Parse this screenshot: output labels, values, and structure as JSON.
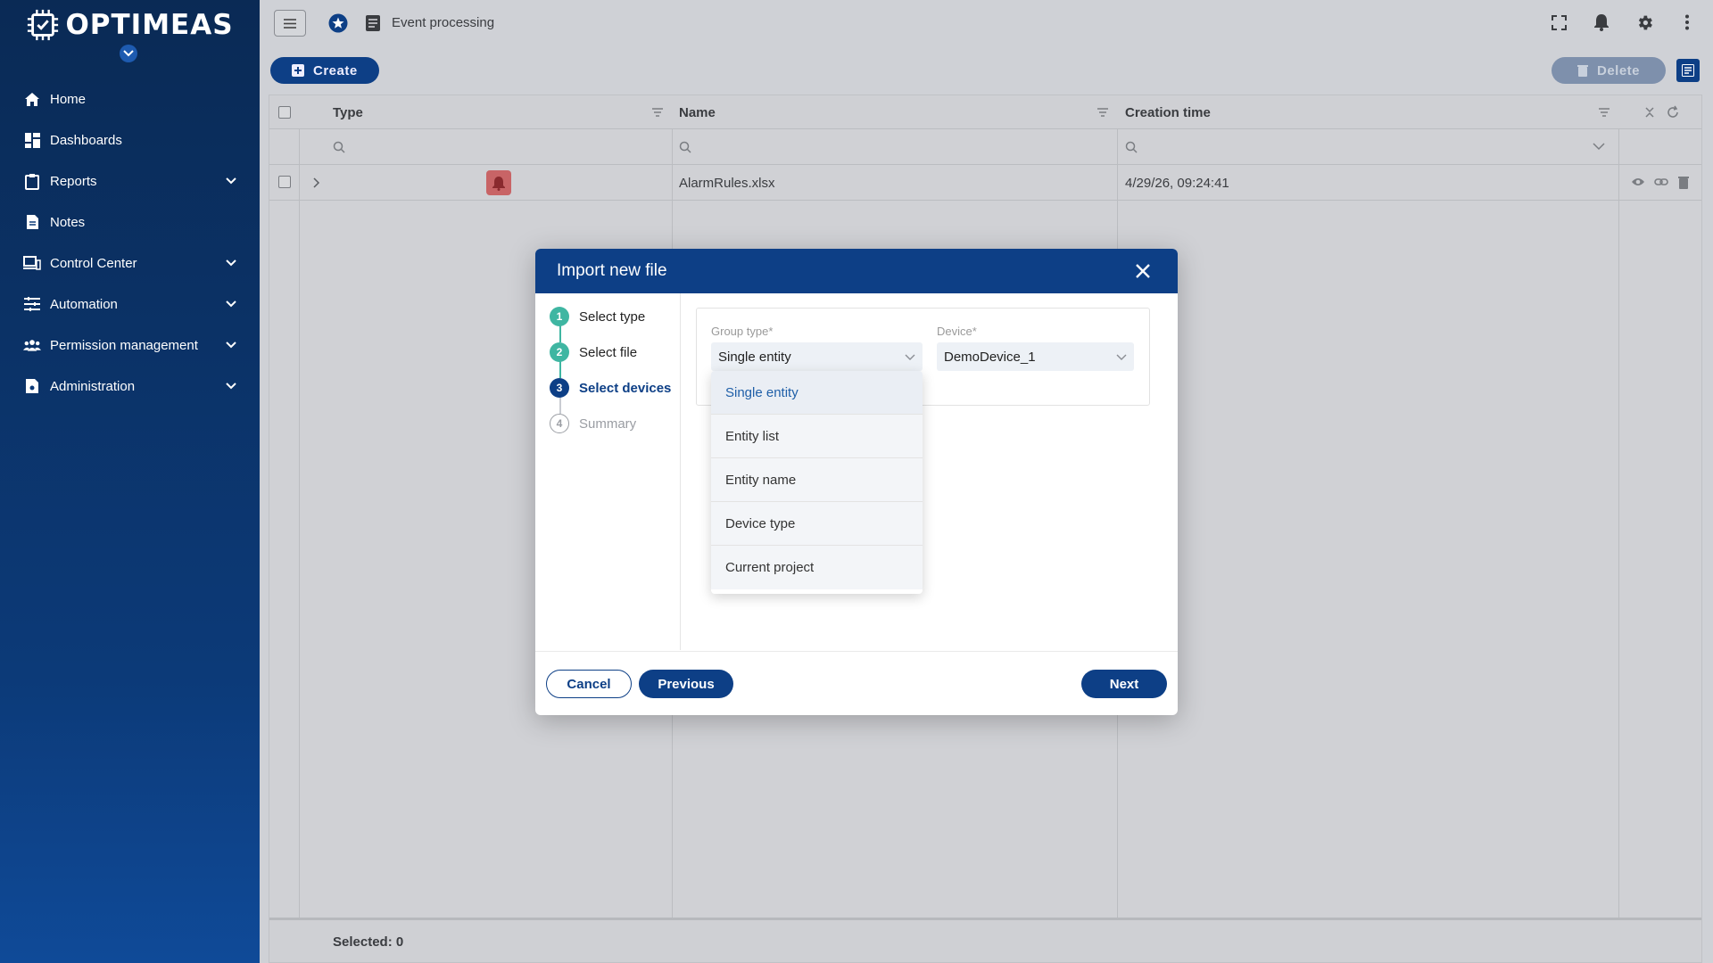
{
  "brand": {
    "name": "OPTIMEAS"
  },
  "sidebar": {
    "items": [
      {
        "label": "Home",
        "icon": "home-icon",
        "expandable": false
      },
      {
        "label": "Dashboards",
        "icon": "dashboard-icon",
        "expandable": false
      },
      {
        "label": "Reports",
        "icon": "clipboard-icon",
        "expandable": true
      },
      {
        "label": "Notes",
        "icon": "note-icon",
        "expandable": false
      },
      {
        "label": "Control Center",
        "icon": "devices-icon",
        "expandable": true
      },
      {
        "label": "Automation",
        "icon": "sliders-icon",
        "expandable": true
      },
      {
        "label": "Permission management",
        "icon": "users-icon",
        "expandable": true
      },
      {
        "label": "Administration",
        "icon": "admin-doc-icon",
        "expandable": true
      }
    ]
  },
  "topbar": {
    "breadcrumb": "Event processing"
  },
  "toolbar": {
    "create_label": "Create",
    "delete_label": "Delete"
  },
  "table": {
    "columns": [
      "Type",
      "Name",
      "Creation time"
    ],
    "rows": [
      {
        "type_icon": "alarm-bell-icon",
        "name": "AlarmRules.xlsx",
        "created": "4/29/26, 09:24:41"
      }
    ],
    "footer": "Selected: 0"
  },
  "modal": {
    "title": "Import new file",
    "steps": [
      {
        "num": "1",
        "label": "Select type",
        "state": "done"
      },
      {
        "num": "2",
        "label": "Select file",
        "state": "done"
      },
      {
        "num": "3",
        "label": "Select devices",
        "state": "active"
      },
      {
        "num": "4",
        "label": "Summary",
        "state": "pending"
      }
    ],
    "group_type": {
      "label": "Group type*",
      "value": "Single entity"
    },
    "device": {
      "label": "Device*",
      "value": "DemoDevice_1"
    },
    "dropdown_options": [
      "Single entity",
      "Entity list",
      "Entity name",
      "Device type",
      "Current project"
    ],
    "cancel_label": "Cancel",
    "previous_label": "Previous",
    "next_label": "Next"
  },
  "colors": {
    "primary": "#0d3f86",
    "step_done": "#3fb6a2",
    "sidebar": "#0c3a78"
  }
}
